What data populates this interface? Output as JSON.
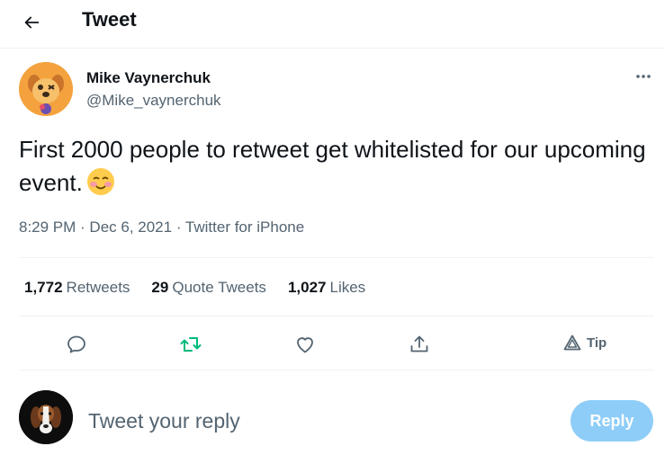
{
  "header": {
    "title": "Tweet"
  },
  "author": {
    "name": "Mike Vaynerchuk",
    "handle": "@Mike_vaynerchuk"
  },
  "tweet": {
    "text": "First 2000 people to retweet get whitelisted for our upcoming event.",
    "time": "8:29 PM",
    "separator1": " · ",
    "date": "Dec 6, 2021",
    "separator2": " · ",
    "source": "Twitter for iPhone"
  },
  "stats": [
    {
      "count": "1,772",
      "label": "Retweets"
    },
    {
      "count": "29",
      "label": "Quote Tweets"
    },
    {
      "count": "1,027",
      "label": "Likes"
    }
  ],
  "actions": {
    "tip_label": "Tip"
  },
  "reply": {
    "placeholder": "Tweet your reply",
    "button_label": "Reply"
  },
  "colors": {
    "text_primary": "#0f1419",
    "text_secondary": "#536471",
    "retweet_active": "#00ba7c",
    "reply_button": "#8ecdf8",
    "divider": "#eff3f4"
  },
  "icons": {
    "back": "arrow-left-icon",
    "more": "more-dots-icon",
    "reply": "speech-bubble-icon",
    "retweet": "retweet-icon",
    "like": "heart-icon",
    "share": "share-icon",
    "tip": "tip-icon",
    "emoji": "smiling-face-emoji"
  }
}
